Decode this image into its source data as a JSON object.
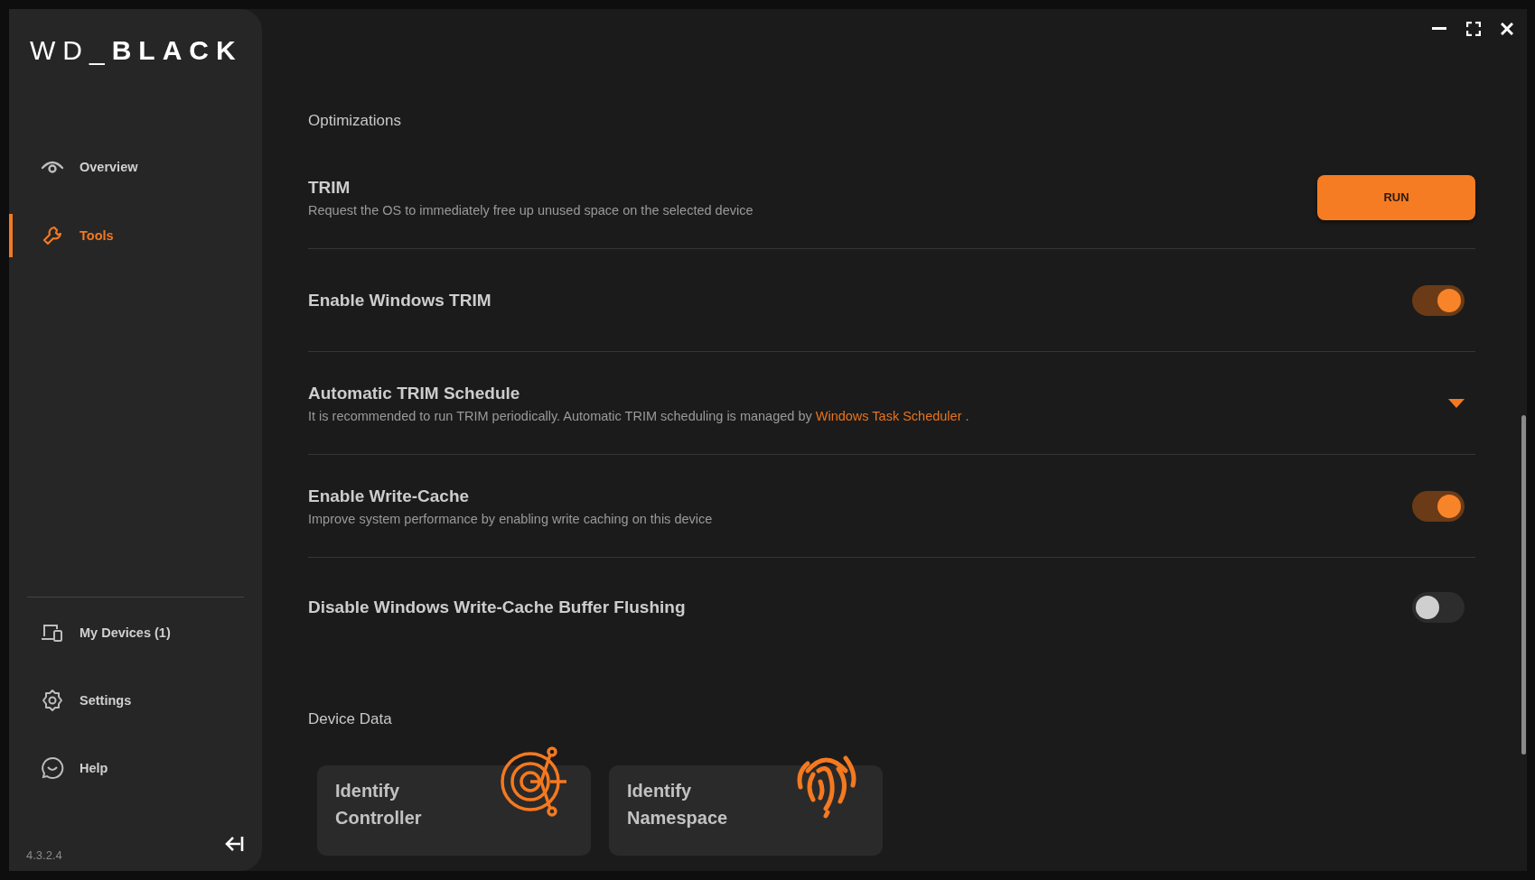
{
  "sidebar": {
    "logo": "WD_**BLACK**",
    "nav": [
      {
        "label": "Overview",
        "selected": false
      },
      {
        "label": "Tools",
        "selected": true
      }
    ],
    "bottom_nav": [
      {
        "label": "My Devices (1)"
      },
      {
        "label": "Settings"
      },
      {
        "label": "Help"
      }
    ],
    "version": "4.3.2.4"
  },
  "sections": [
    {
      "title": "Optimizations",
      "rows": [
        {
          "kind": "action",
          "title": "TRIM",
          "description": "Request the OS to immediately free up unused space on the selected device",
          "button": "RUN"
        },
        {
          "kind": "toggle",
          "title": "Enable Windows TRIM",
          "on": true
        },
        {
          "kind": "expand",
          "title": "Automatic TRIM Schedule",
          "description": "It is recommended to run TRIM periodically. Automatic TRIM scheduling is managed by",
          "link": "Windows Task Scheduler",
          "description_end": ".",
          "expanded": false
        },
        {
          "kind": "toggle",
          "title": "Enable Write-Cache",
          "description": "Improve system performance by enabling write caching on this device",
          "on": true
        },
        {
          "kind": "toggle",
          "title": "Disable Windows Write-Cache Buffer Flushing",
          "on": false
        }
      ]
    },
    {
      "title": "Device Data",
      "cards": [
        {
          "label": "Identify Controller"
        },
        {
          "label": "Identify Namespace"
        }
      ]
    }
  ]
}
